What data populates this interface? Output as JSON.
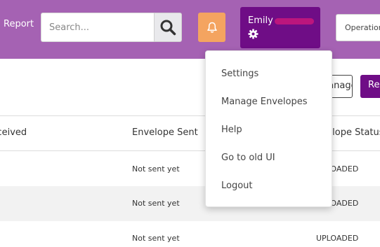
{
  "header": {
    "nav_report": "Report",
    "search_placeholder": "Search...",
    "user_name": "Emily",
    "operation_label": "Operation"
  },
  "toolbar": {
    "outline_button_label": "Manage Envelope",
    "primary_button_label": "Re"
  },
  "table": {
    "headers": [
      "Received",
      "Envelope Sent",
      "Envelope Status"
    ],
    "rows": [
      {
        "sent": "Not sent yet",
        "status": "UPLOADED"
      },
      {
        "sent": "Not sent yet",
        "status": "UPLOADED"
      },
      {
        "sent": "Not sent yet",
        "status": "UPLOADED"
      }
    ]
  },
  "user_menu": {
    "items": [
      "Settings",
      "Manage Envelopes",
      "Help",
      "Go to old UI",
      "Logout"
    ]
  },
  "colors": {
    "header_bg": "#a562b3",
    "user_button": "#6f0d86",
    "bell_button": "#f4a460"
  }
}
